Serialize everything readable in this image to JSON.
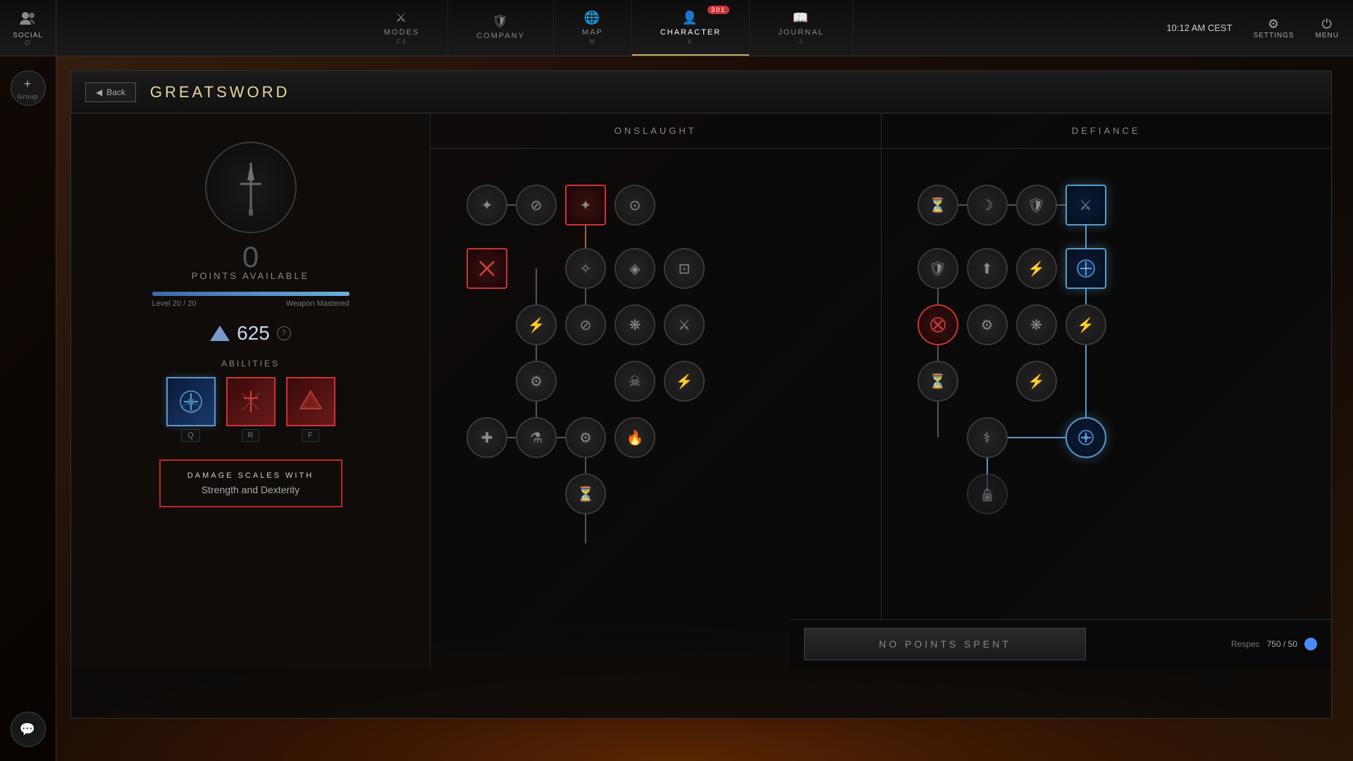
{
  "topbar": {
    "social_label": "SOCIAL",
    "social_key": "O",
    "modes_label": "MODES",
    "modes_key": "F4",
    "company_label": "COMPANY",
    "company_key": "",
    "map_label": "MAP",
    "map_key": "M",
    "character_label": "CHARACTER",
    "character_key": "K",
    "character_badge": "301",
    "journal_label": "JOURNAL",
    "journal_key": "J",
    "clock": "10:12 AM CEST",
    "settings_label": "SETTINGS",
    "menu_label": "MENU"
  },
  "panel": {
    "back_label": "Back",
    "title": "GREATSWORD"
  },
  "left_panel": {
    "points_value": "0",
    "points_label": "POINTS AVAILABLE",
    "level_current": "20",
    "level_max": "20",
    "weapon_status": "Weapon Mastered",
    "progress_percent": 100,
    "score": "625",
    "abilities_label": "ABILITIES",
    "ability_keys": [
      "Q",
      "R",
      "F"
    ],
    "damage_scales_title": "DAMAGE SCALES WITH",
    "damage_scales_value": "Strength and Dexterity"
  },
  "skill_tree": {
    "onslaught_label": "ONSLAUGHT",
    "defiance_label": "DEFIANCE",
    "no_points_label": "NO POINTS SPENT",
    "respec_label": "Respec",
    "respec_cost": "750 / 50"
  }
}
